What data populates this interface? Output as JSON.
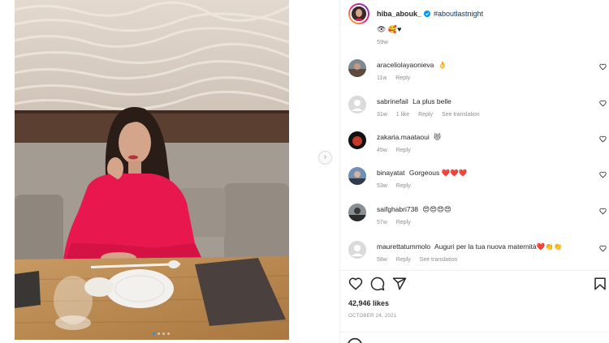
{
  "post": {
    "owner": "hiba_abouk_",
    "hashtag": "#aboutlastnight",
    "caption_emojis": "👁 🥰♥",
    "time_ago": "59w",
    "likes": "42,946 likes",
    "date": "OCTOBER 24, 2021"
  },
  "carousel": {
    "next_symbol": "›",
    "slide_count": 4,
    "active_index": 0
  },
  "comments": [
    {
      "user": "araceliolayaonieva",
      "text": "👌",
      "age": "11w",
      "likes": "",
      "reply": "Reply",
      "translation": ""
    },
    {
      "user": "sabrinefail",
      "text": "La plus belle",
      "age": "31w",
      "likes": "1 like",
      "reply": "Reply",
      "translation": "See translation"
    },
    {
      "user": "zakaria.maataoui",
      "text": "😻",
      "age": "45w",
      "likes": "",
      "reply": "Reply",
      "translation": ""
    },
    {
      "user": "binayatat",
      "text": "Gorgeous ❤️❤️❤️",
      "age": "53w",
      "likes": "",
      "reply": "Reply",
      "translation": ""
    },
    {
      "user": "saifghabri738",
      "text": "😍😍😍😍",
      "age": "57w",
      "likes": "",
      "reply": "Reply",
      "translation": ""
    },
    {
      "user": "maurettatummolo",
      "text": "Auguri per la tua nuova maternità❤️👏👏",
      "age": "58w",
      "likes": "",
      "reply": "Reply",
      "translation": "See translation"
    }
  ],
  "colors": {
    "link": "#00376b",
    "muted": "#8e8e8e",
    "text": "#262626",
    "verified": "#0095f6"
  },
  "icons": [
    "verified-badge-icon",
    "heart-icon",
    "comment-icon",
    "share-icon",
    "bookmark-icon",
    "chevron-right-icon"
  ]
}
